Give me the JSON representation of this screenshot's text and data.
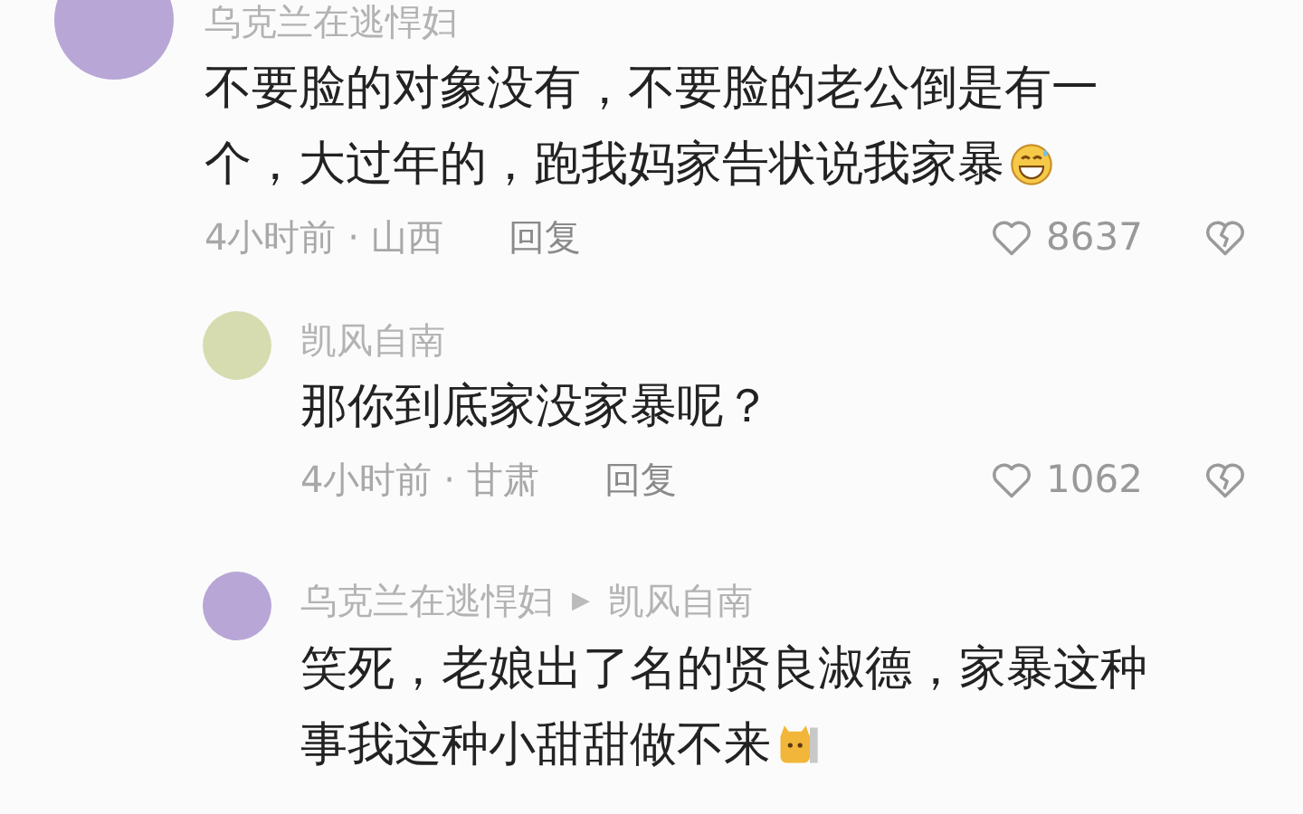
{
  "comments": [
    {
      "author": "乌克兰在逃悍妇",
      "lines": [
        "不要脸的对象没有，不要脸的老公倒是有一",
        "个，大过年的，跑我妈家告状说我家暴"
      ],
      "emoji": {
        "kind": "grin"
      },
      "time_location": "4小时前 · 山西",
      "reply_label": "回复",
      "likes": "8637",
      "children": [
        {
          "author": "凯风自南",
          "lines": [
            "那你到底家没家暴呢？"
          ],
          "time_location": "4小时前 · 甘肃",
          "reply_label": "回复",
          "likes": "1062"
        },
        {
          "author": "乌克兰在逃悍妇",
          "reply_arrow": "▶",
          "reply_to": "凯风自南",
          "lines": [
            "笑死，老娘出了名的贤良淑德，家暴这种",
            "事我这种小甜甜做不来"
          ],
          "emoji": {
            "kind": "cat"
          }
        }
      ]
    }
  ]
}
